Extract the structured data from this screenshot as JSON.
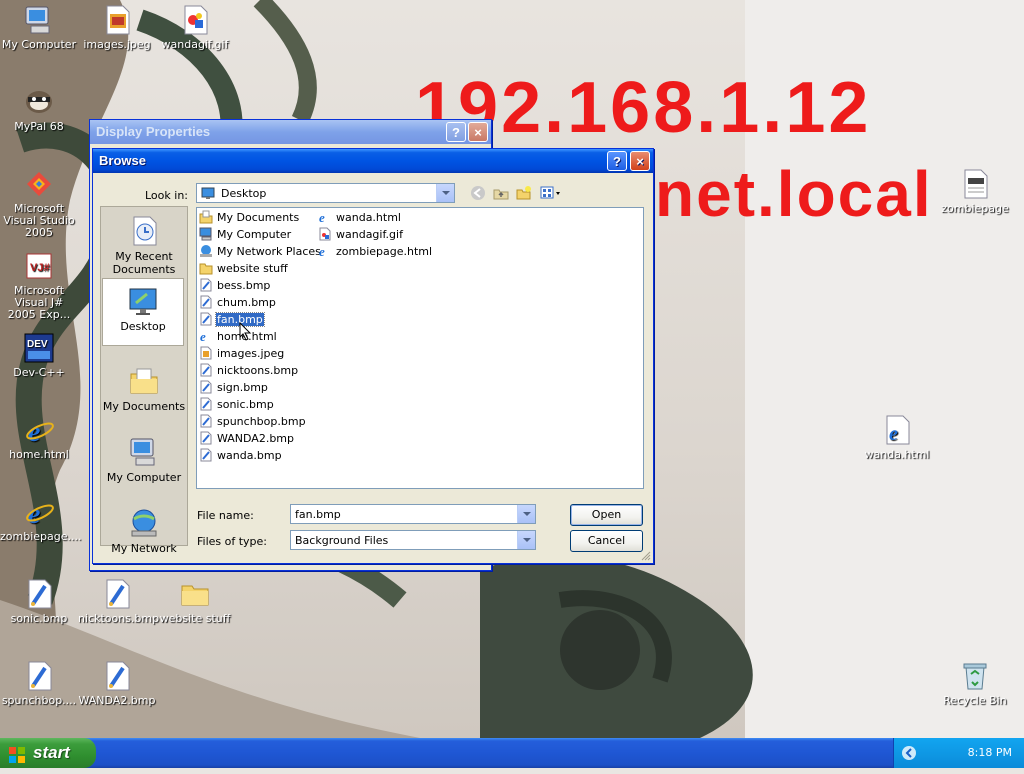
{
  "wallpaper": {
    "ip_text": "192.168.1.12",
    "domain_text": "net.local",
    "text_color": "#ee1b1b"
  },
  "desktop_icons": [
    {
      "label": "My Computer",
      "icon": "my-computer-icon"
    },
    {
      "label": "images.jpeg",
      "icon": "image-file-icon"
    },
    {
      "label": "wandagif.gif",
      "icon": "gif-file-icon"
    },
    {
      "label": "MyPal 68",
      "icon": "raccoon-app-icon"
    },
    {
      "label": "Microsoft Visual Studio 2005",
      "icon": "visual-studio-icon"
    },
    {
      "label": "Microsoft Visual J# 2005 Exp...",
      "icon": "visual-jsharp-icon"
    },
    {
      "label": "Dev-C++",
      "icon": "dev-cpp-icon"
    },
    {
      "label": "home.html",
      "icon": "ie-html-icon"
    },
    {
      "label": "zombiepage....",
      "icon": "ie-html-icon"
    },
    {
      "label": "sonic.bmp",
      "icon": "bitmap-file-icon"
    },
    {
      "label": "nicktoons.bmp",
      "icon": "bitmap-file-icon"
    },
    {
      "label": "website stuff",
      "icon": "folder-icon"
    },
    {
      "label": "spunchbop....",
      "icon": "bitmap-file-icon"
    },
    {
      "label": "WANDA2.bmp",
      "icon": "bitmap-file-icon"
    },
    {
      "label": "zombiepage",
      "icon": "text-file-icon"
    },
    {
      "label": "wanda.html",
      "icon": "ie-html-icon"
    },
    {
      "label": "Recycle Bin",
      "icon": "recycle-bin-icon"
    }
  ],
  "display_properties": {
    "title": "Display Properties"
  },
  "browse": {
    "title": "Browse",
    "look_in_label": "Look in:",
    "look_in_value": "Desktop",
    "places": [
      {
        "label": "My Recent Documents",
        "icon": "recent-documents-icon"
      },
      {
        "label": "Desktop",
        "icon": "desktop-icon"
      },
      {
        "label": "My Documents",
        "icon": "my-documents-icon"
      },
      {
        "label": "My Computer",
        "icon": "my-computer-icon"
      },
      {
        "label": "My Network",
        "icon": "my-network-icon"
      }
    ],
    "files_col1": [
      {
        "name": "My Documents",
        "icon": "my-documents-icon"
      },
      {
        "name": "My Computer",
        "icon": "my-computer-icon"
      },
      {
        "name": "My Network Places",
        "icon": "my-network-icon"
      },
      {
        "name": "website stuff",
        "icon": "folder-icon"
      },
      {
        "name": "bess.bmp",
        "icon": "bitmap-file-icon"
      },
      {
        "name": "chum.bmp",
        "icon": "bitmap-file-icon"
      },
      {
        "name": "fan.bmp",
        "icon": "bitmap-file-icon"
      },
      {
        "name": "home.html",
        "icon": "ie-html-icon"
      },
      {
        "name": "images.jpeg",
        "icon": "image-file-icon"
      },
      {
        "name": "nicktoons.bmp",
        "icon": "bitmap-file-icon"
      },
      {
        "name": "sign.bmp",
        "icon": "bitmap-file-icon"
      },
      {
        "name": "sonic.bmp",
        "icon": "bitmap-file-icon"
      },
      {
        "name": "spunchbop.bmp",
        "icon": "bitmap-file-icon"
      },
      {
        "name": "WANDA2.bmp",
        "icon": "bitmap-file-icon"
      },
      {
        "name": "wanda.bmp",
        "icon": "bitmap-file-icon"
      }
    ],
    "files_col2": [
      {
        "name": "wanda.html",
        "icon": "ie-html-icon"
      },
      {
        "name": "wandagif.gif",
        "icon": "gif-file-icon"
      },
      {
        "name": "zombiepage.html",
        "icon": "ie-html-icon"
      }
    ],
    "selected_file": "fan.bmp",
    "file_name_label": "File name:",
    "file_name_value": "fan.bmp",
    "files_of_type_label": "Files of type:",
    "files_of_type_value": "Background Files",
    "open_label": "Open",
    "cancel_label": "Cancel",
    "help_glyph": "?",
    "close_glyph": "×"
  },
  "taskbar": {
    "start_label": "start",
    "clock": "8:18 PM"
  },
  "colors": {
    "xp_blue": "#0054e3",
    "selection": "#316ac5",
    "start_green": "#3c9d3c"
  }
}
